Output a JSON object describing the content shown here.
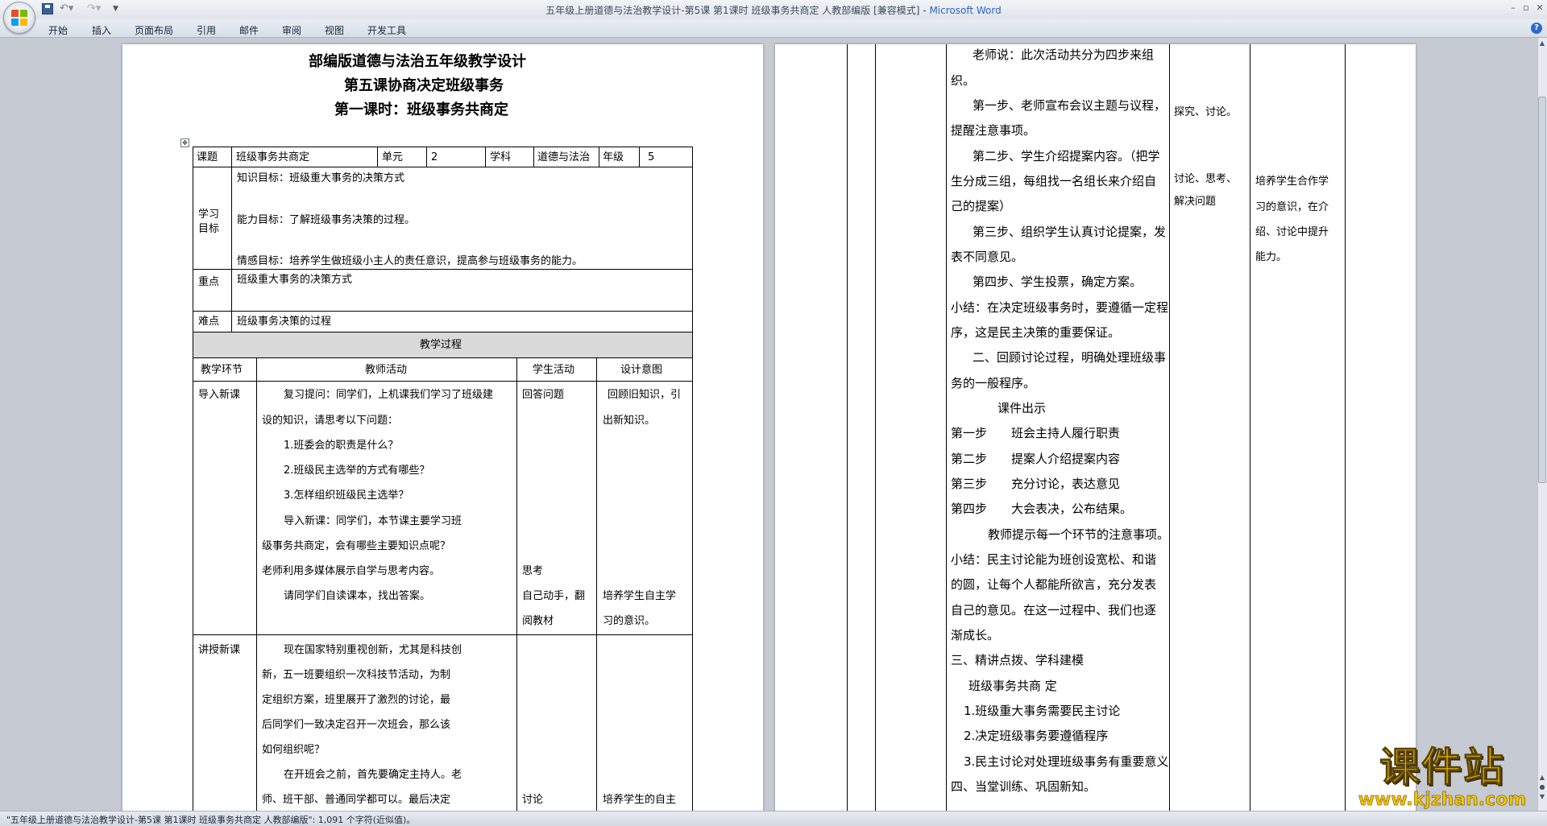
{
  "window": {
    "title": "五年级上册道德与法治教学设计-第5课 第1课时 班级事务共商定 人教部编版 [兼容模式] - ",
    "app_name": "Microsoft Word"
  },
  "quick_access": {
    "icons": [
      "save-icon",
      "undo-icon",
      "redo-icon",
      "dropdown-icon"
    ]
  },
  "ribbon": {
    "tabs": [
      "开始",
      "插入",
      "页面布局",
      "引用",
      "邮件",
      "审阅",
      "视图",
      "开发工具"
    ]
  },
  "page1": {
    "title1": "部编版道德与法治五年级教学设计",
    "title2": "第五课协商决定班级事务",
    "title3": "第一课时：班级事务共商定",
    "info": {
      "topic_label": "课题",
      "topic_value": "班级事务共商定",
      "unit_label": "单元",
      "unit_value": "2",
      "subject_label": "学科",
      "subject_value": "道德与法治",
      "grade_label": "年级",
      "grade_value": "5"
    },
    "goals_label": [
      "学习",
      "目标"
    ],
    "goals": [
      "知识目标：班级重大事务的决策方式",
      "能力目标：了解班级事务决策的过程。",
      "情感目标：培养学生做班级小主人的责任意识，提高参与班级事务的能力。"
    ],
    "focus_label": "重点",
    "focus_value": "班级重大事务的决策方式",
    "difficulty_label": "难点",
    "difficulty_value": "班级事务决策的过程",
    "process_title": "教学过程",
    "columns": [
      "教学环节",
      "教师活动",
      "学生活动",
      "设计意图"
    ],
    "stage1": {
      "name": "导入新课",
      "teacher": [
        "复习提问：同学们，上机课我们学习了班级建",
        "设的知识，请思考以下问题：",
        "1.班委会的职责是什么？",
        "2.班级民主选举的方式有哪些？",
        "3.怎样组织班级民主选举？",
        "导入新课：同学们，本节课主要学习班",
        "级事务共商定，会有哪些主要知识点呢？",
        "老师利用多媒体展示自学与思考内容。",
        "请同学们自读课本，找出答案。"
      ],
      "student": [
        "回答问题",
        "思考",
        "自己动手，翻",
        "阅教材"
      ],
      "intent": [
        "回顾旧知识，引",
        "出新知识。",
        "培养学生自主学",
        "习的意识。"
      ]
    },
    "stage2": {
      "name": "讲授新课",
      "teacher": [
        "现在国家特别重视创新，尤其是科技创",
        "新，五一班要组织一次科技节活动，为制",
        "定组织方案，班里展开了激烈的讨论，最",
        "后同学们一致决定召开一次班会，那么该",
        "如何组织呢？",
        "在开班会之前，首先要确定主持人。老",
        "师、班干部、普通同学都可以。最后决定"
      ],
      "student": [
        "讨论"
      ],
      "intent": [
        "培养学生的自主"
      ]
    }
  },
  "page2": {
    "lines": [
      "老师说：此次活动共分为四步来组",
      "织。",
      "第一步、老师宣布会议主题与议程，",
      "提醒注意事项。",
      "第二步、学生介绍提案内容。（把学",
      "生分成三组，每组找一名组长来介绍自",
      "己的提案）",
      "第三步、组织学生认真讨论提案，发",
      "表不同意见。",
      "第四步、学生投票，确定方案。",
      "小结：在决定班级事务时，要遵循一定程",
      "序，这是民主决策的重要保证。",
      "二、回顾讨论过程，明确处理班级事",
      "务的一般程序。",
      "课件出示",
      "第一步　　班会主持人履行职责",
      "第二步　　提案人介绍提案内容",
      "第三步　　充分讨论，表达意见",
      "第四步　　大会表决，公布结果。",
      "教师提示每一个环节的注意事项。",
      "小结：民主讨论能为班创设宽松、和谐",
      "的圆，让每个人都能所欲言，充分发表",
      "自己的意见。在这一过程中、我们也逐",
      "渐成长。",
      "三、精讲点拨、学科建模",
      "班级事务共商 定",
      "1.班级重大事务需要民主讨论",
      "2.决定班级事务要遵循程序",
      "3.民主讨论对处理班级事务有重要意义",
      "四、当堂训练、巩固新知。"
    ],
    "student": [
      "探究、讨论。",
      "讨论、思考、",
      "解决问题"
    ],
    "intent": [
      "培养学生合作学",
      "习的意识，在介",
      "绍、讨论中提升",
      "能力。"
    ]
  },
  "status_bar": {
    "text": "\"五年级上册道德与法治教学设计-第5课 第1课时 班级事务共商定 人教部编版\": 1,091 个字符(近似值)。"
  },
  "watermark": {
    "title": "课件站",
    "url": "www.kjzhan.com"
  },
  "colors": {
    "process_header_bg": "#d9d9d9",
    "title_bar": "#dfe4ea",
    "watermark": "#f2c200",
    "brand": "#2b63c4"
  }
}
